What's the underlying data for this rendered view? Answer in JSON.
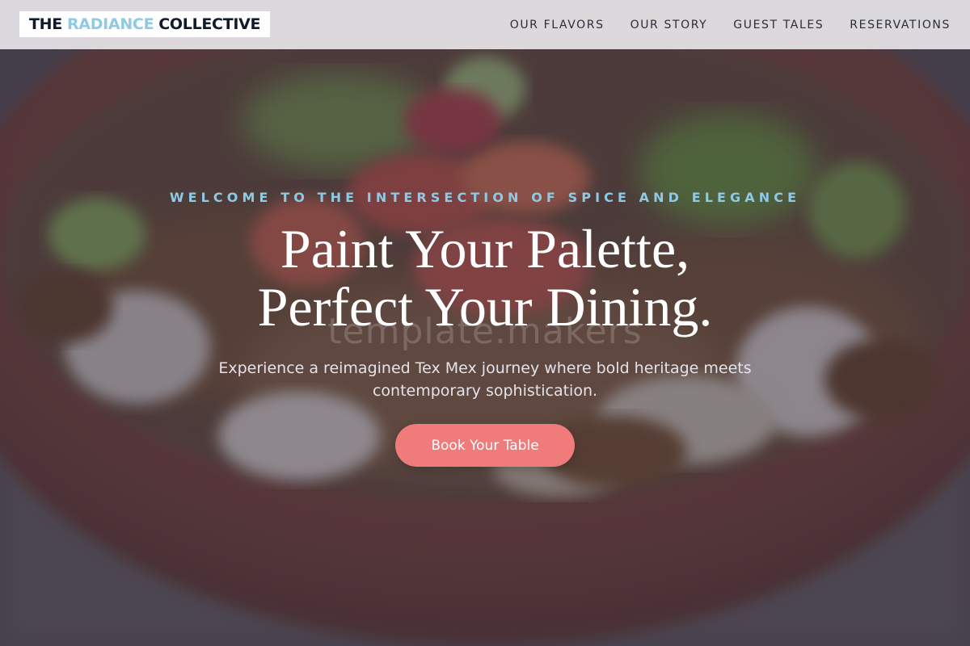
{
  "brand": {
    "part1": "THE",
    "part2": "RADIANCE",
    "part3": "COLLECTIVE"
  },
  "nav": {
    "links": [
      {
        "label": "OUR FLAVORS"
      },
      {
        "label": "OUR STORY"
      },
      {
        "label": "GUEST TALES"
      },
      {
        "label": "RESERVATIONS"
      }
    ]
  },
  "hero": {
    "eyebrow": "WELCOME TO THE INTERSECTION OF SPICE AND ELEGANCE",
    "headline_line1": "Paint Your Palette,",
    "headline_line2": "Perfect Your Dining.",
    "watermark": "template.makers",
    "subtext": "Experience a reimagined Tex Mex journey where bold heritage meets contemporary sophistication.",
    "cta_label": "Book Your Table"
  },
  "colors": {
    "accent_blue": "#8ecae6",
    "cta_coral": "#f07b7b",
    "brand_dark": "#0f1b2d",
    "nav_text": "#2b2d3a"
  }
}
